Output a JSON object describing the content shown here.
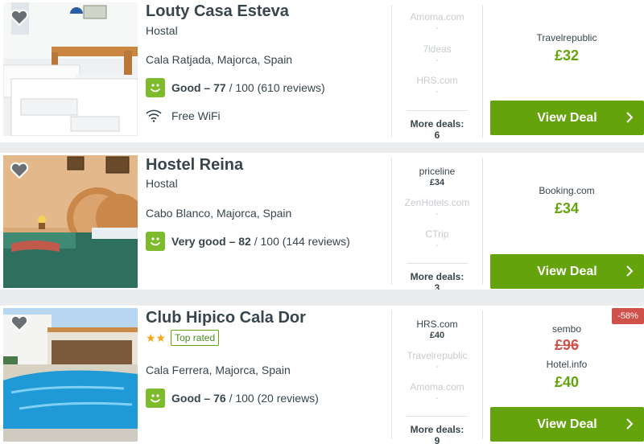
{
  "colors": {
    "accent": "#65a30d",
    "rating_badge": "#7dbb2c",
    "discount": "#d0514b",
    "star": "#f4a614"
  },
  "hotels": [
    {
      "name": "Louty Casa Esteva",
      "type": "Hostal",
      "location": "Cala Ratjada, Majorca, Spain",
      "rating_label": "Good – 77",
      "rating_rest": " / 100 (610 reviews)",
      "amenity": "Free WiFi",
      "deals": [
        {
          "provider": "Amoma.com",
          "price": "-"
        },
        {
          "provider": "7ideas",
          "price": "-"
        },
        {
          "provider": "HRS.com",
          "price": "-"
        }
      ],
      "more_deals": "More deals: 6",
      "best_provider": "Travelrepublic",
      "best_price": "£32",
      "button": "View Deal"
    },
    {
      "name": "Hostel Reina",
      "type": "Hostal",
      "location": "Cabo Blanco, Majorca, Spain",
      "rating_label": "Very good – 82",
      "rating_rest": " / 100 (144 reviews)",
      "deals": [
        {
          "provider": "priceline",
          "price": "£34"
        },
        {
          "provider": "ZenHotels.com",
          "price": "-"
        },
        {
          "provider": "CTrip",
          "price": "-"
        }
      ],
      "more_deals": "More deals: 3",
      "best_provider": "Booking.com",
      "best_price": "£34",
      "button": "View Deal"
    },
    {
      "name": "Club Hipico Cala Dor",
      "stars": "★★",
      "star_count": 2,
      "badge": "Top rated",
      "location": "Cala Ferrera, Majorca, Spain",
      "rating_label": "Good – 76",
      "rating_rest": " / 100 (20 reviews)",
      "deals": [
        {
          "provider": "HRS.com",
          "price": "£40"
        },
        {
          "provider": "Travelrepublic",
          "price": "-"
        },
        {
          "provider": "Amoma.com",
          "price": "-"
        }
      ],
      "more_deals": "More deals: 9",
      "discount": "-58%",
      "struck_provider": "sembo",
      "struck_price": "£96",
      "best_provider": "Hotel.info",
      "best_price": "£40",
      "button": "View Deal"
    }
  ]
}
